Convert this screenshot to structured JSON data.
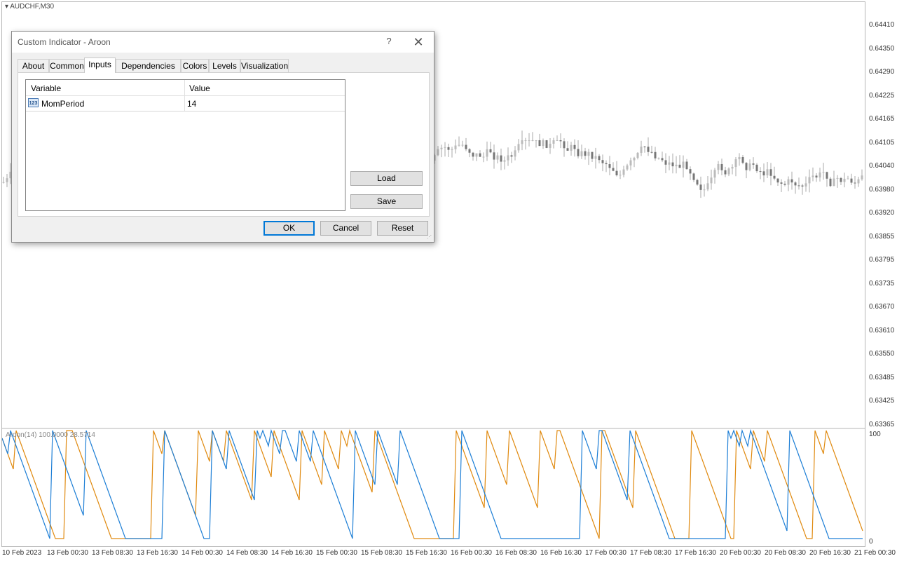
{
  "chart": {
    "symbol": "AUDCHF,M30",
    "indicator_label": "Aroon(14) 100.0000 28.5714",
    "price_ticks": [
      "0.64410",
      "0.64350",
      "0.64290",
      "0.64225",
      "0.64165",
      "0.64105",
      "0.64040",
      "0.63980",
      "0.63920",
      "0.63855",
      "0.63795",
      "0.63735",
      "0.63670",
      "0.63610",
      "0.63550",
      "0.63485",
      "0.63425",
      "0.63365"
    ],
    "indicator_ticks": [
      "100",
      "0"
    ],
    "time_ticks": [
      "10 Feb 2023",
      "13 Feb 00:30",
      "13 Feb 08:30",
      "13 Feb 16:30",
      "14 Feb 00:30",
      "14 Feb 08:30",
      "14 Feb 16:30",
      "15 Feb 00:30",
      "15 Feb 08:30",
      "15 Feb 16:30",
      "16 Feb 00:30",
      "16 Feb 08:30",
      "16 Feb 16:30",
      "17 Feb 00:30",
      "17 Feb 08:30",
      "17 Feb 16:30",
      "20 Feb 00:30",
      "20 Feb 08:30",
      "20 Feb 16:30",
      "21 Feb 00:30"
    ],
    "colors": {
      "aroon_up": "#1e7fd6",
      "aroon_down": "#e08a10",
      "candle": "#8c8c8c"
    }
  },
  "dialog": {
    "title": "Custom Indicator - Aroon",
    "help": "?",
    "close": "✕",
    "tabs": [
      "About",
      "Common",
      "Inputs",
      "Dependencies",
      "Colors",
      "Levels",
      "Visualization"
    ],
    "active_tab": "Inputs",
    "grid": {
      "headers": [
        "Variable",
        "Value"
      ],
      "rows": [
        {
          "icon": "123",
          "variable": "MomPeriod",
          "value": "14"
        }
      ]
    },
    "buttons": {
      "load": "Load",
      "save": "Save",
      "ok": "OK",
      "cancel": "Cancel",
      "reset": "Reset"
    }
  }
}
